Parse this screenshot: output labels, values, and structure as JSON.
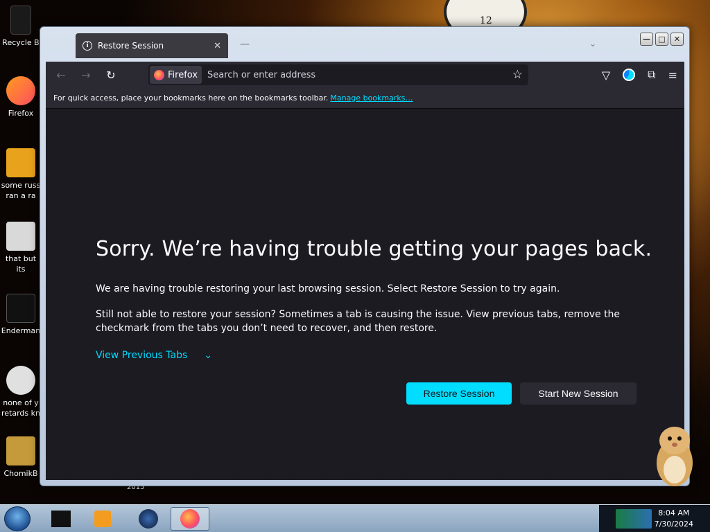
{
  "desktop": {
    "icons": [
      {
        "label": "Recycle B"
      },
      {
        "label": "Firefox"
      },
      {
        "label": "some russ ran a ra"
      },
      {
        "label": "that but its"
      },
      {
        "label": "Enderman"
      },
      {
        "label": "none of y retards kn"
      },
      {
        "label": "ChomikB"
      }
    ],
    "year_label": "2015"
  },
  "window": {
    "tab_title": "Restore Session",
    "controls": {
      "minimize": "—",
      "maximize": "□",
      "close": "✕"
    }
  },
  "toolbar": {
    "identity_label": "Firefox",
    "url_placeholder": "Search or enter address"
  },
  "bookmarks_bar": {
    "message": "For quick access, place your bookmarks here on the bookmarks toolbar.",
    "link": "Manage bookmarks…"
  },
  "content": {
    "headline": "Sorry. We’re having trouble getting your pages back.",
    "paragraph1": "We are having trouble restoring your last browsing session. Select Restore Session to try again.",
    "paragraph2": "Still not able to restore your session? Sometimes a tab is causing the issue. View previous tabs, remove the checkmark from the tabs you don’t need to recover, and then restore.",
    "view_previous": "View Previous Tabs",
    "restore_button": "Restore Session",
    "new_session_button": "Start New Session"
  },
  "taskbar": {
    "time": "8:04 AM",
    "date": "7/30/2024"
  },
  "colors": {
    "accent": "#00ddff",
    "content_bg": "#1c1b22",
    "toolbar_bg": "#2b2a33"
  }
}
